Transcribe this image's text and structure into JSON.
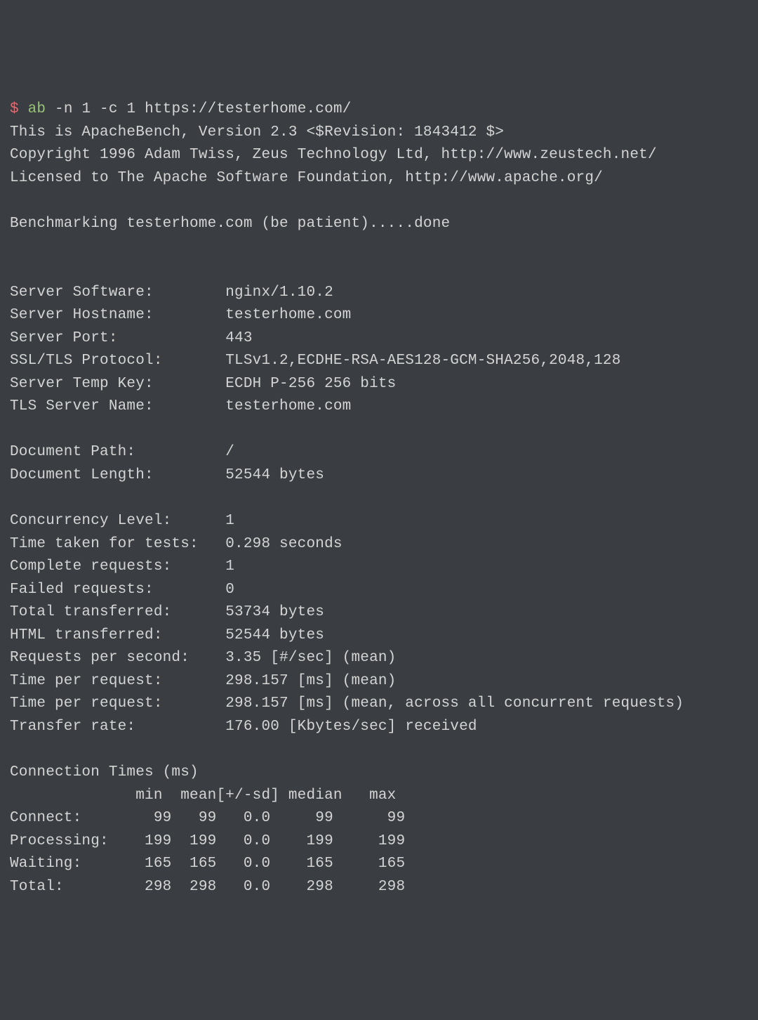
{
  "prompt": {
    "dollar": "$",
    "command": "ab",
    "args": "-n 1 -c 1 https://testerhome.com/"
  },
  "header": {
    "line1": "This is ApacheBench, Version 2.3 <$Revision: 1843412 $>",
    "line2": "Copyright 1996 Adam Twiss, Zeus Technology Ltd, http://www.zeustech.net/",
    "line3": "Licensed to The Apache Software Foundation, http://www.apache.org/"
  },
  "benchmark_line": "Benchmarking testerhome.com (be patient).....done",
  "server": {
    "software_label": "Server Software:",
    "software_value": "nginx/1.10.2",
    "hostname_label": "Server Hostname:",
    "hostname_value": "testerhome.com",
    "port_label": "Server Port:",
    "port_value": "443",
    "ssl_label": "SSL/TLS Protocol:",
    "ssl_value": "TLSv1.2,ECDHE-RSA-AES128-GCM-SHA256,2048,128",
    "tempkey_label": "Server Temp Key:",
    "tempkey_value": "ECDH P-256 256 bits",
    "tlsname_label": "TLS Server Name:",
    "tlsname_value": "testerhome.com"
  },
  "document": {
    "path_label": "Document Path:",
    "path_value": "/",
    "length_label": "Document Length:",
    "length_value": "52544 bytes"
  },
  "results": {
    "concurrency_label": "Concurrency Level:",
    "concurrency_value": "1",
    "time_label": "Time taken for tests:",
    "time_value": "0.298 seconds",
    "complete_label": "Complete requests:",
    "complete_value": "1",
    "failed_label": "Failed requests:",
    "failed_value": "0",
    "total_label": "Total transferred:",
    "total_value": "53734 bytes",
    "html_label": "HTML transferred:",
    "html_value": "52544 bytes",
    "rps_label": "Requests per second:",
    "rps_value": "3.35 [#/sec] (mean)",
    "tpr1_label": "Time per request:",
    "tpr1_value": "298.157 [ms] (mean)",
    "tpr2_label": "Time per request:",
    "tpr2_value": "298.157 [ms] (mean, across all concurrent requests)",
    "rate_label": "Transfer rate:",
    "rate_value": "176.00 [Kbytes/sec] received"
  },
  "conn": {
    "title": "Connection Times (ms)",
    "header": "              min  mean[+/-sd] median   max",
    "rows": [
      {
        "label": "Connect:",
        "min": "99",
        "mean": "99",
        "sd": "0.0",
        "median": "99",
        "max": "99"
      },
      {
        "label": "Processing:",
        "min": "199",
        "mean": "199",
        "sd": "0.0",
        "median": "199",
        "max": "199"
      },
      {
        "label": "Waiting:",
        "min": "165",
        "mean": "165",
        "sd": "0.0",
        "median": "165",
        "max": "165"
      },
      {
        "label": "Total:",
        "min": "298",
        "mean": "298",
        "sd": "0.0",
        "median": "298",
        "max": "298"
      }
    ]
  }
}
